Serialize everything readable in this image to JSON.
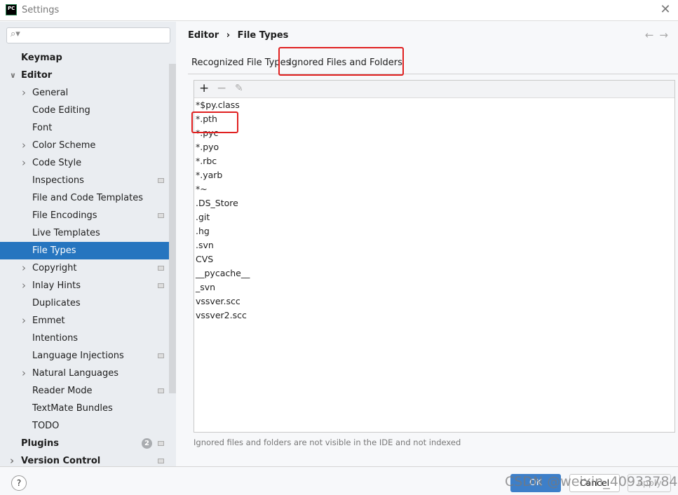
{
  "window": {
    "title": "Settings",
    "logo": "PC"
  },
  "search": {
    "placeholder": ""
  },
  "sidebar": {
    "items": [
      {
        "label": "Keymap",
        "level": 0,
        "bold": true
      },
      {
        "label": "Editor",
        "level": 0,
        "bold": true,
        "expanded": true
      },
      {
        "label": "General",
        "level": 1,
        "chevron": true
      },
      {
        "label": "Code Editing",
        "level": 1
      },
      {
        "label": "Font",
        "level": 1
      },
      {
        "label": "Color Scheme",
        "level": 1,
        "chevron": true
      },
      {
        "label": "Code Style",
        "level": 1,
        "chevron": true
      },
      {
        "label": "Inspections",
        "level": 1,
        "mod": true
      },
      {
        "label": "File and Code Templates",
        "level": 1
      },
      {
        "label": "File Encodings",
        "level": 1,
        "mod": true
      },
      {
        "label": "Live Templates",
        "level": 1
      },
      {
        "label": "File Types",
        "level": 1,
        "selected": true
      },
      {
        "label": "Copyright",
        "level": 1,
        "chevron": true,
        "mod": true
      },
      {
        "label": "Inlay Hints",
        "level": 1,
        "chevron": true,
        "mod": true
      },
      {
        "label": "Duplicates",
        "level": 1
      },
      {
        "label": "Emmet",
        "level": 1,
        "chevron": true
      },
      {
        "label": "Intentions",
        "level": 1
      },
      {
        "label": "Language Injections",
        "level": 1,
        "mod": true
      },
      {
        "label": "Natural Languages",
        "level": 1,
        "chevron": true
      },
      {
        "label": "Reader Mode",
        "level": 1,
        "mod": true
      },
      {
        "label": "TextMate Bundles",
        "level": 1
      },
      {
        "label": "TODO",
        "level": 1
      },
      {
        "label": "Plugins",
        "level": 0,
        "bold": true,
        "count": "2",
        "mod": true
      },
      {
        "label": "Version Control",
        "level": 0,
        "bold": true,
        "chevron": true,
        "mod": true
      }
    ]
  },
  "breadcrumb": {
    "parent": "Editor",
    "sep": "›",
    "current": "File Types"
  },
  "tabs": [
    {
      "label": "Recognized File Types"
    },
    {
      "label": "Ignored Files and Folders",
      "selected": true
    }
  ],
  "toolbar": {
    "add": "+",
    "remove": "−",
    "edit": "✎"
  },
  "patterns": [
    "*$py.class",
    "*.pth",
    "*.pyc",
    "*.pyo",
    "*.rbc",
    "*.yarb",
    "*~",
    ".DS_Store",
    ".git",
    ".hg",
    ".svn",
    "CVS",
    "__pycache__",
    "_svn",
    "vssver.scc",
    "vssver2.scc"
  ],
  "hint": "Ignored files and folders are not visible in the IDE and not indexed",
  "footer": {
    "help": "?",
    "ok": "OK",
    "cancel": "Cancel",
    "apply": "Apply",
    "watermark": "CSDN @weixin_40933784"
  },
  "colors": {
    "selection": "#2675bf",
    "highlight": "#e02020",
    "ok": "#3d7fc9"
  }
}
